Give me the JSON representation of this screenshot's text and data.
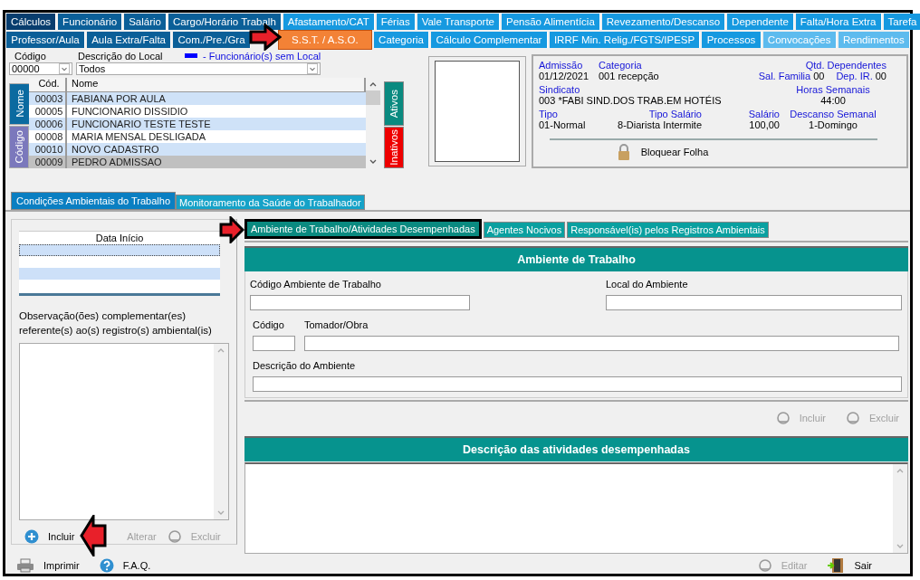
{
  "tab_rows": [
    {
      "tabs": [
        {
          "label": "Cálculos",
          "color": "#083d6e",
          "selected": false
        },
        {
          "label": "Funcionário",
          "color": "#0b5f98",
          "selected": false
        },
        {
          "label": "Salário",
          "color": "#0b5f98",
          "selected": false
        },
        {
          "label": "Cargo/Horário Trabalh",
          "color": "#0b5f98",
          "selected": false
        },
        {
          "label": "Afastamento/CAT",
          "color": "#1699e0",
          "selected": false
        },
        {
          "label": "Férias",
          "color": "#1699e0",
          "selected": false
        },
        {
          "label": "Vale Transporte",
          "color": "#1699e0",
          "selected": false
        },
        {
          "label": "Pensão Alimentícia",
          "color": "#1699e0",
          "selected": false
        },
        {
          "label": "Revezamento/Descanso",
          "color": "#1699e0",
          "selected": false
        },
        {
          "label": "Dependente",
          "color": "#1699e0",
          "selected": false
        },
        {
          "label": "Falta/Hora Extra",
          "color": "#1699e0",
          "selected": false
        },
        {
          "label": "Tarefa",
          "color": "#1699e0",
          "selected": false
        }
      ]
    },
    {
      "tabs": [
        {
          "label": "Professor/Aula",
          "color": "#0b5f98",
          "selected": false
        },
        {
          "label": "Aula Extra/Falta",
          "color": "#0b5f98",
          "selected": false
        },
        {
          "label": "Com./Pre./Gra",
          "color": "#0b5f98",
          "selected": false
        },
        {
          "label": "S.S.T. / A.S.O.",
          "selected": true
        },
        {
          "label": "Categoria",
          "color": "#1699e0",
          "selected": false
        },
        {
          "label": "Cálculo Complementar",
          "color": "#1699e0",
          "selected": false
        },
        {
          "label": "IRRF Min. Relig./FGTS/IPESP",
          "color": "#1699e0",
          "selected": false
        },
        {
          "label": "Processos",
          "color": "#1699e0",
          "selected": false
        },
        {
          "label": "Convocações",
          "color": "#5dbbee",
          "selected": false
        },
        {
          "label": "Rendimentos",
          "color": "#5dbbee",
          "selected": false
        }
      ]
    }
  ],
  "filter": {
    "code_label": "Código",
    "code_value": "00000",
    "local_label": "Descrição do Local",
    "local_value": "Todos",
    "legend_text": "- Funcionário(s) sem Local"
  },
  "employee_list": {
    "sort_tabs": [
      {
        "label": "Nome",
        "color": "#0b6aa0",
        "selected": true
      },
      {
        "label": "Código",
        "color": "#7b78bc",
        "selected": false
      }
    ],
    "columns": [
      "Cód.",
      "Nome"
    ],
    "rows": [
      {
        "code": "00003",
        "name": "FABIANA POR AULA",
        "selected": false
      },
      {
        "code": "00005",
        "name": "FUNCIONARIO DISSIDIO",
        "selected": false
      },
      {
        "code": "00006",
        "name": "FUNCIONARIO TESTE TESTE",
        "selected": false
      },
      {
        "code": "00008",
        "name": "MARIA MENSAL DESLIGADA",
        "selected": false
      },
      {
        "code": "00010",
        "name": "NOVO CADASTRO",
        "selected": false
      },
      {
        "code": "00009",
        "name": "PEDRO ADMISSAO",
        "selected": true
      }
    ],
    "status_tabs": [
      {
        "label": "Ativos",
        "color": "#0a8a80",
        "selected": true
      },
      {
        "label": "Inativos",
        "color": "#ee0000",
        "selected": false
      }
    ]
  },
  "info": {
    "admissao_label": "Admissão",
    "admissao": "01/12/2021",
    "categoria_label": "Categoria",
    "categoria": "001  recepção",
    "dependentes_label": "Qtd. Dependentes",
    "sal_familia_label": "Sal. Familia",
    "sal_familia": "00",
    "dep_ir_label": "Dep. IR.",
    "dep_ir": "00",
    "sindicato_label": "Sindicato",
    "sindicato": "003  *FABI SIND.DOS TRAB.EM HOTÉIS",
    "horas_label": "Horas Semanais",
    "horas": "44:00",
    "tipo_label": "Tipo",
    "tipo": "01-Normal",
    "tipo_salario_label": "Tipo Salário",
    "tipo_salario": "8-Diarista Intermite",
    "salario_label": "Salário",
    "salario": "100,00",
    "descanso_label": "Descanso Semanal",
    "descanso": "1-Domingo",
    "lock_button": "Bloquear Folha"
  },
  "section_tabs": [
    {
      "label": "Condições Ambientais do Trabalho",
      "selected": true
    },
    {
      "label": "Monitoramento da Saúde do Trabalhador",
      "selected": false
    }
  ],
  "history": {
    "column": "Data Início",
    "observation_label": "Observação(ões) complementar(es) referente(s) ao(s) registro(s) ambiental(is)",
    "buttons": [
      {
        "label": "Incluir",
        "kind": "add",
        "disabled": false
      },
      {
        "label": "Alterar",
        "kind": "none",
        "disabled": true
      },
      {
        "label": "Excluir",
        "kind": "remove",
        "disabled": true
      }
    ]
  },
  "env_tabs": [
    {
      "label": "Ambiente de Trabalho/Atividades Desempenhadas",
      "selected": true
    },
    {
      "label": "Agentes Nocivos",
      "selected": false
    },
    {
      "label": "Responsável(is) pelos Registros Ambientais",
      "selected": false
    }
  ],
  "ambiente": {
    "title": "Ambiente de Trabalho",
    "code_label": "Código Ambiente de Trabalho",
    "local_label": "Local do Ambiente",
    "codigo_label": "Código",
    "tomador_label": "Tomador/Obra",
    "descricao_label": "Descrição do Ambiente",
    "buttons": [
      {
        "label": "Incluir",
        "disabled": true
      },
      {
        "label": "Excluir",
        "disabled": true
      }
    ]
  },
  "atividades": {
    "title": "Descrição das atividades desempenhadas"
  },
  "footer": {
    "left": [
      {
        "label": "Imprimir",
        "kind": "print"
      },
      {
        "label": "F.A.Q.",
        "kind": "help"
      }
    ],
    "right": [
      {
        "label": "Editar",
        "kind": "edit",
        "disabled": true
      },
      {
        "label": "Sair",
        "kind": "exit",
        "disabled": false
      }
    ]
  }
}
